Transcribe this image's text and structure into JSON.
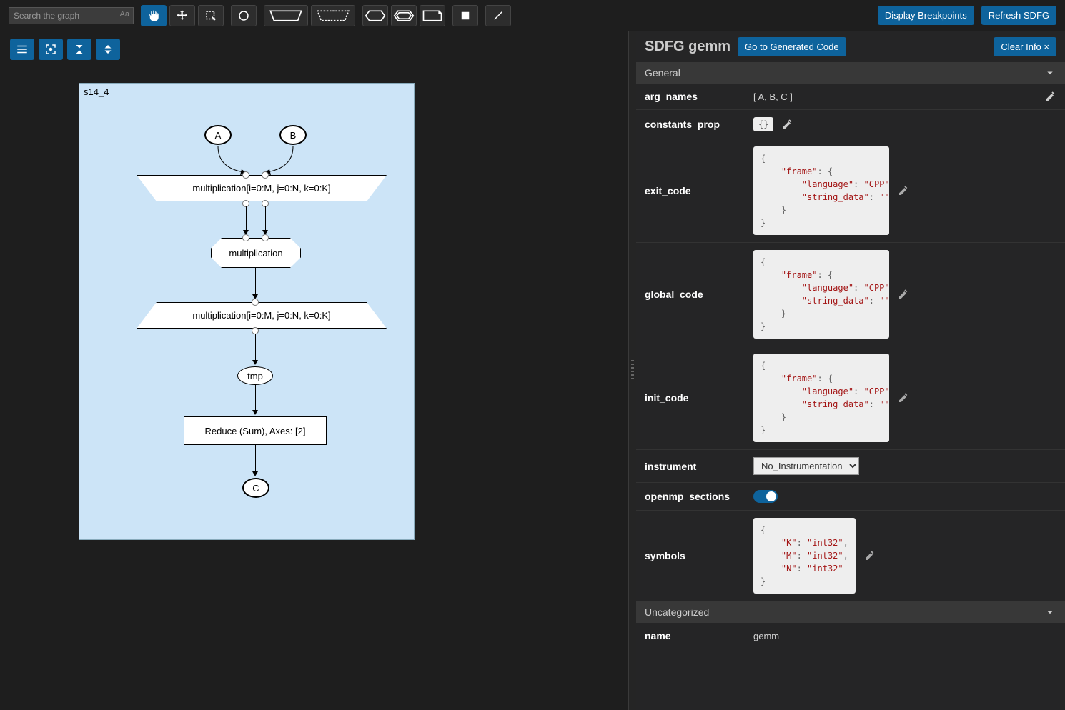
{
  "search": {
    "placeholder": "Search the graph",
    "case_label": "Aa"
  },
  "topbar": {
    "display_breakpoints": "Display Breakpoints",
    "refresh_sdfg": "Refresh SDFG"
  },
  "graph": {
    "state_label": "s14_4",
    "node_a": "A",
    "node_b": "B",
    "map_entry": "multiplication[i=0:M, j=0:N, k=0:K]",
    "tasklet": "multiplication",
    "map_exit": "multiplication[i=0:M, j=0:N, k=0:K]",
    "tmp": "tmp",
    "reduce": "Reduce (Sum), Axes: [2]",
    "node_c": "C"
  },
  "panel": {
    "title_prefix": "SDFG ",
    "sdfg_name": "gemm",
    "goto_code": "Go to Generated Code",
    "clear_info": "Clear Info ×",
    "sections": {
      "general": "General",
      "uncategorized": "Uncategorized"
    },
    "props": {
      "arg_names": {
        "label": "arg_names",
        "value": "[ A, B, C ]"
      },
      "constants_prop": {
        "label": "constants_prop",
        "badge": "{}"
      },
      "exit_code": {
        "label": "exit_code"
      },
      "global_code": {
        "label": "global_code"
      },
      "init_code": {
        "label": "init_code"
      },
      "instrument": {
        "label": "instrument",
        "value": "No_Instrumentation"
      },
      "openmp_sections": {
        "label": "openmp_sections",
        "value": true
      },
      "symbols": {
        "label": "symbols"
      },
      "name": {
        "label": "name",
        "value": "gemm"
      }
    },
    "code_frame": {
      "open": "{",
      "frame_key": "\"frame\"",
      "frame_open": ": {",
      "lang_key": "\"language\"",
      "lang_val": "\"CPP\"",
      "str_key": "\"string_data\"",
      "str_val": "\"\"",
      "close_inner": "}",
      "close": "}"
    },
    "symbols_json": {
      "open": "{",
      "k": "\"K\"",
      "kv": "\"int32\"",
      "m": "\"M\"",
      "mv": "\"int32\"",
      "n": "\"N\"",
      "nv": "\"int32\"",
      "close": "}"
    }
  }
}
